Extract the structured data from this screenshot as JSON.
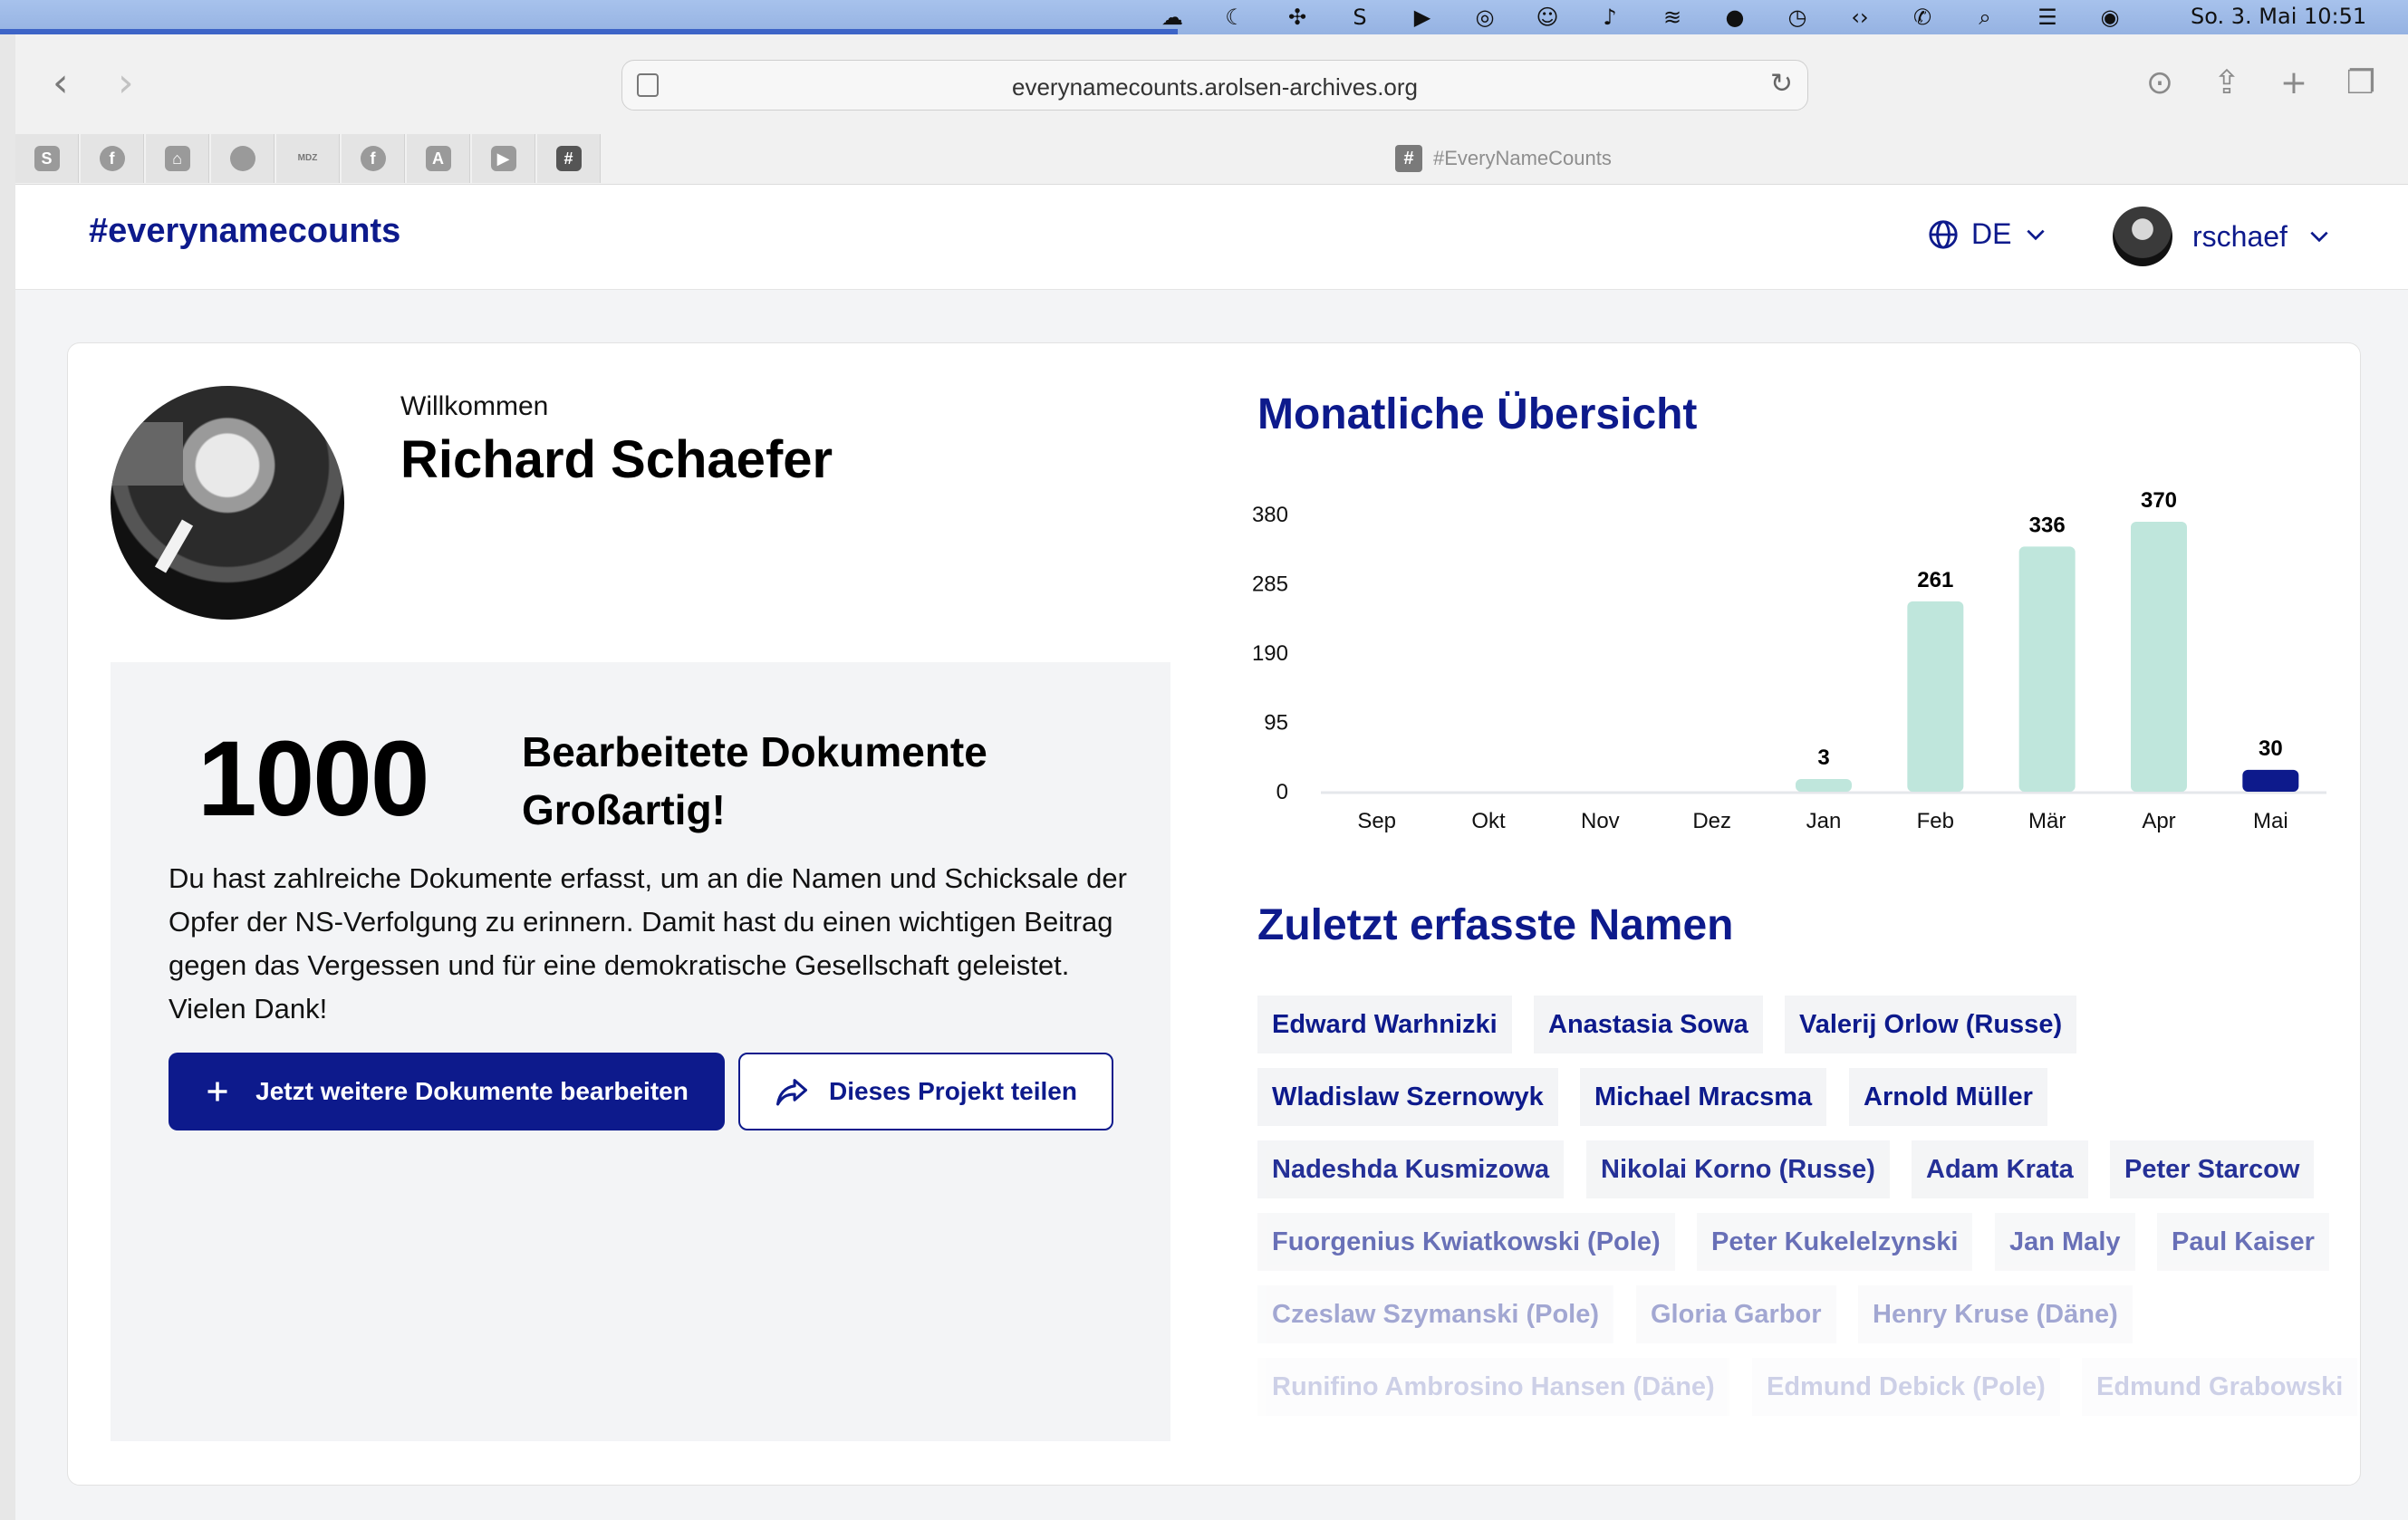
{
  "menubar": {
    "icons": [
      "creative-cloud-icon",
      "moon-icon",
      "dropbox-icon",
      "shazam-icon",
      "play-icon",
      "airdrop-icon",
      "accessibility-icon",
      "hearing-icon",
      "wifi-icon",
      "user-icon",
      "time-machine-icon",
      "code-icon",
      "phone-icon",
      "search-icon",
      "control-center-icon",
      "siri-icon"
    ],
    "clock": "So. 3. Mai  10:51"
  },
  "browser": {
    "url": "everynamecounts.arolsen-archives.org",
    "active_tab": "#EveryNameCounts",
    "favorites": [
      {
        "icon": "scribd-icon",
        "glyph": "S"
      },
      {
        "icon": "facebook-icon",
        "glyph": "f"
      },
      {
        "icon": "museum-icon",
        "glyph": "⌂"
      },
      {
        "icon": "apple-icon",
        "glyph": ""
      },
      {
        "icon": "mdz-icon",
        "glyph": "MDZ"
      },
      {
        "icon": "facebook-icon",
        "glyph": "f"
      },
      {
        "icon": "font-icon",
        "glyph": "A"
      },
      {
        "icon": "youtube-icon",
        "glyph": "▶"
      },
      {
        "icon": "hashtag-icon",
        "glyph": "#"
      }
    ]
  },
  "header": {
    "logo": "#everynamecounts",
    "language": "DE",
    "username": "rschaef"
  },
  "profile": {
    "welcome": "Willkommen",
    "name": "Richard Schaefer"
  },
  "stats": {
    "count": "1000",
    "title_line1": "Bearbeitete Dokumente",
    "title_line2": "Großartig!",
    "text": "Du hast zahlreiche Dokumente erfasst, um an die Namen und Schicksale der Opfer der NS-Verfolgung zu erinnern. Damit hast du einen wichtigen Beitrag gegen das Vergessen und für eine demokratische Gesellschaft geleistet. Vielen Dank!",
    "primary_button": "Jetzt weitere Dokumente bearbeiten",
    "secondary_button": "Dieses Projekt teilen"
  },
  "monthly": {
    "heading": "Monatliche Übersicht"
  },
  "chart_data": {
    "type": "bar",
    "title": "Monatliche Übersicht",
    "categories": [
      "Sep",
      "Okt",
      "Nov",
      "Dez",
      "Jan",
      "Feb",
      "Mär",
      "Apr",
      "Mai"
    ],
    "values": [
      0,
      0,
      0,
      0,
      3,
      261,
      336,
      370,
      30
    ],
    "value_labels": [
      "",
      "",
      "",
      "",
      "3",
      "261",
      "336",
      "370",
      "30"
    ],
    "yticks": [
      0,
      95,
      190,
      285,
      380
    ],
    "ylim": [
      0,
      380
    ],
    "colors": {
      "bar": "#bfe6dc",
      "current": "#0d1a8c"
    },
    "grid": false
  },
  "recent": {
    "heading": "Zuletzt erfasste Namen",
    "rows": [
      [
        "Edward Warhnizki",
        "Anastasia Sowa",
        "Valerij Orlow (Russe)"
      ],
      [
        "Wladislaw Szernowyk",
        "Michael Mracsma",
        "Arnold Müller"
      ],
      [
        "Nadeshda Kusmizowa",
        "Nikolai Korno (Russe)",
        "Adam Krata",
        "Peter Starcow"
      ],
      [
        "Fuorgenius Kwiatkowski (Pole)",
        "Peter Kukelelzynski",
        "Jan Maly",
        "Paul Kaiser"
      ],
      [
        "Czeslaw Szymanski (Pole)",
        "Gloria Garbor",
        "Henry Kruse (Däne)"
      ],
      [
        "Runifino Ambrosino Hansen (Däne)",
        "Edmund Debick (Pole)",
        "Edmund Grabowski"
      ]
    ]
  },
  "colors": {
    "brand": "#0d1a8c",
    "bar": "#bfe6dc",
    "panel": "#f3f4f6"
  }
}
